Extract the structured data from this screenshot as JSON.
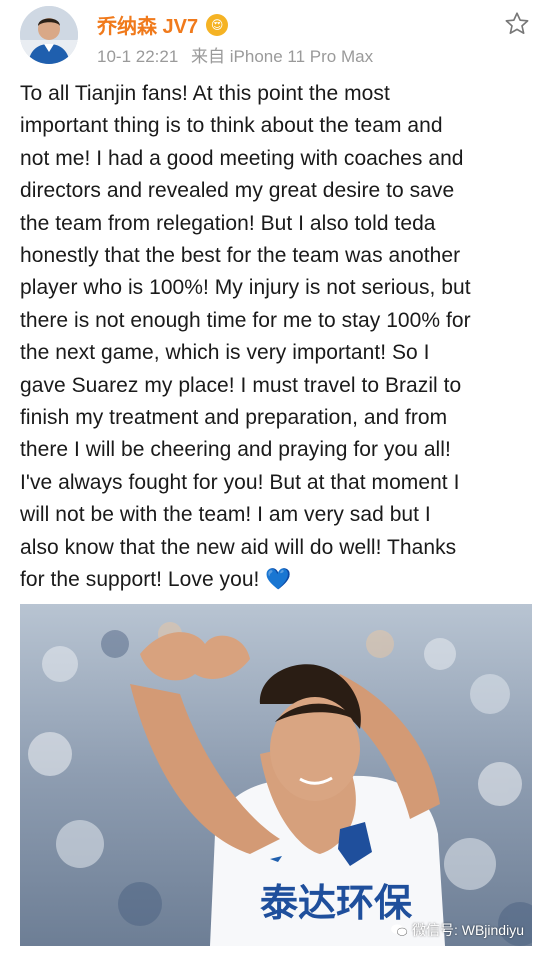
{
  "post": {
    "author": "乔纳森 JV7",
    "time": "10-1 22:21",
    "source": "来自 iPhone 11 Pro Max",
    "text_lines": [
      "To all Tianjin fans!  At this point the most",
      "important thing is to think about the team and",
      "not me!  I had a good meeting with coaches and",
      "directors and revealed my great desire to save",
      "the team from relegation!  But I also told teda",
      "honestly that the best for the team was another",
      "player who is 100%!  My injury is not serious, but",
      "there is not enough time for me to stay 100% for",
      "the next game, which is very important!  So I",
      "gave Suarez my place!  I must travel to Brazil to",
      "finish my treatment and preparation, and from",
      "there I will be cheering and praying for you all!",
      "I've always fought for you!  But at that moment I",
      "will not be with the team!  I am very sad but I",
      "also know that the new aid will do well!  Thanks",
      "for the support!  Love you! "
    ],
    "heart_emoji": "💙"
  },
  "photo": {
    "jersey_text": "泰达环保",
    "watermark": "微信号: WBjindiyu"
  },
  "icons": {
    "favorite": "star-icon",
    "verified": "badge-icon",
    "watermark": "wechat-icon"
  },
  "colors": {
    "username": "#f07a1c",
    "heart": "#2a7cf0"
  }
}
